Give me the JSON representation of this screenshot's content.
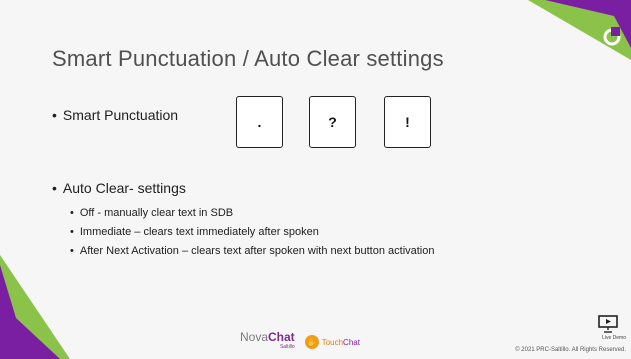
{
  "slide": {
    "title": "Smart Punctuation / Auto Clear settings",
    "smart_punctuation": {
      "label": "Smart Punctuation",
      "keys": [
        ".",
        "?",
        "!"
      ]
    },
    "auto_clear": {
      "label": "Auto Clear- settings",
      "items": [
        "Off - manually clear text in SDB",
        "Immediate – clears text immediately after spoken",
        "After Next Activation – clears text after spoken with next button activation"
      ]
    },
    "logos": {
      "novachat_prefix": "Nova",
      "novachat_suffix": "Chat",
      "novachat_sub": "Saltillo",
      "touchchat_prefix": "Touch",
      "touchchat_suffix": "Chat"
    },
    "live_demo": "Live Demo",
    "copyright": "© 2021 PRC-Saltillo. All Rights Reserved."
  },
  "colors": {
    "accent_purple": "#7b1fa2",
    "accent_green": "#8bc34a",
    "brand_orange": "#f29a1f"
  }
}
